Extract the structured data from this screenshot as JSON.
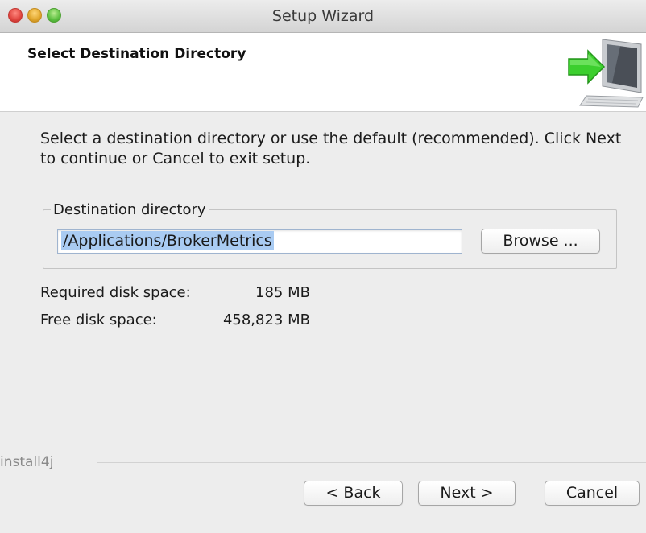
{
  "window": {
    "title": "Setup Wizard"
  },
  "header": {
    "title": "Select Destination Directory",
    "icon": "installer-monitor-arrow-icon"
  },
  "main": {
    "instructions": "Select a destination directory or use the default  (recommended).  Click Next to continue or Cancel to exit setup.",
    "group_label": "Destination directory",
    "destination_value": "/Applications/BrokerMetrics",
    "browse_label": "Browse ...",
    "required_label": "Required disk space:",
    "required_value": "185 MB",
    "free_label": "Free disk space:",
    "free_value": "458,823 MB"
  },
  "footer": {
    "brand": "install4j",
    "back_label": "< Back",
    "next_label": "Next >",
    "cancel_label": "Cancel"
  },
  "colors": {
    "selection": "#a9cbf2",
    "close": "#e0443e",
    "minimize": "#e0a52a",
    "maximize": "#5bbf3f",
    "arrow": "#3ccf2e"
  }
}
